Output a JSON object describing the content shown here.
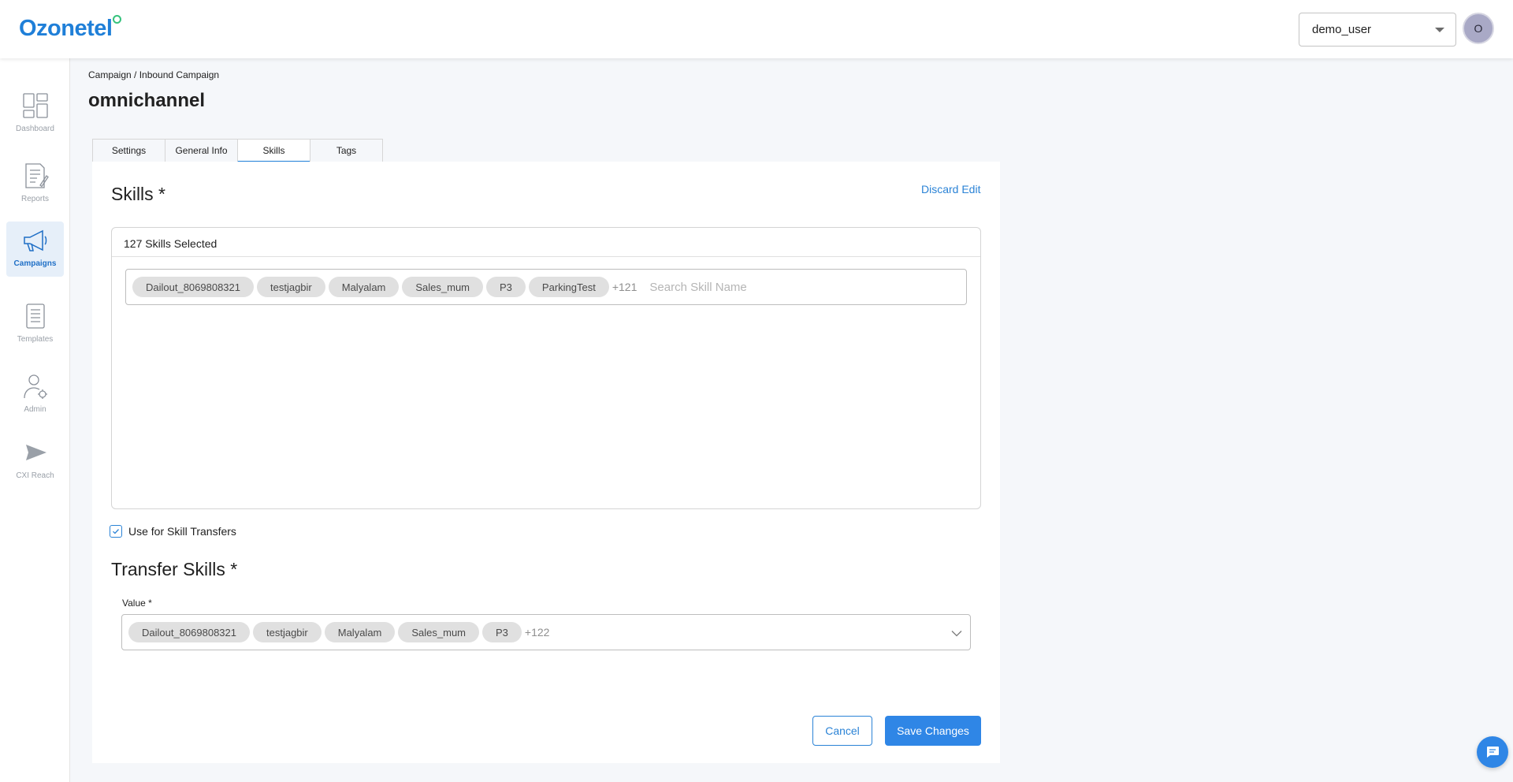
{
  "brand": {
    "name": "Ozonetel"
  },
  "header": {
    "user": "demo_user",
    "avatar_initial": "O"
  },
  "sidebar": {
    "items": [
      {
        "label": "Dashboard",
        "icon": "dashboard-icon"
      },
      {
        "label": "Reports",
        "icon": "reports-icon"
      },
      {
        "label": "Campaigns",
        "icon": "campaigns-icon",
        "active": true
      },
      {
        "label": "Templates",
        "icon": "templates-icon"
      },
      {
        "label": "Admin",
        "icon": "admin-icon"
      },
      {
        "label": "CXI Reach",
        "icon": "cxi-reach-icon"
      }
    ]
  },
  "breadcrumb": "Campaign / Inbound Campaign",
  "page_title": "omnichannel",
  "tabs": [
    {
      "label": "Settings"
    },
    {
      "label": "General Info"
    },
    {
      "label": "Skills",
      "active": true
    },
    {
      "label": "Tags"
    }
  ],
  "skills": {
    "title": "Skills *",
    "discard": "Discard Edit",
    "selected_count": "127 Skills Selected",
    "chips": [
      "Dailout_8069808321",
      "testjagbir",
      "Malyalam",
      "Sales_mum",
      "P3",
      "ParkingTest"
    ],
    "more": "+121",
    "search_placeholder": "Search Skill Name"
  },
  "use_for_transfers": {
    "label": "Use for Skill Transfers",
    "checked": true
  },
  "transfer": {
    "title": "Transfer Skills *",
    "value_label": "Value *",
    "chips": [
      "Dailout_8069808321",
      "testjagbir",
      "Malyalam",
      "Sales_mum",
      "P3"
    ],
    "more": "+122"
  },
  "actions": {
    "cancel": "Cancel",
    "save": "Save Changes"
  },
  "colors": {
    "primary": "#2f86e6",
    "brand": "#1f7fd8",
    "brand_dot": "#36c27d"
  }
}
